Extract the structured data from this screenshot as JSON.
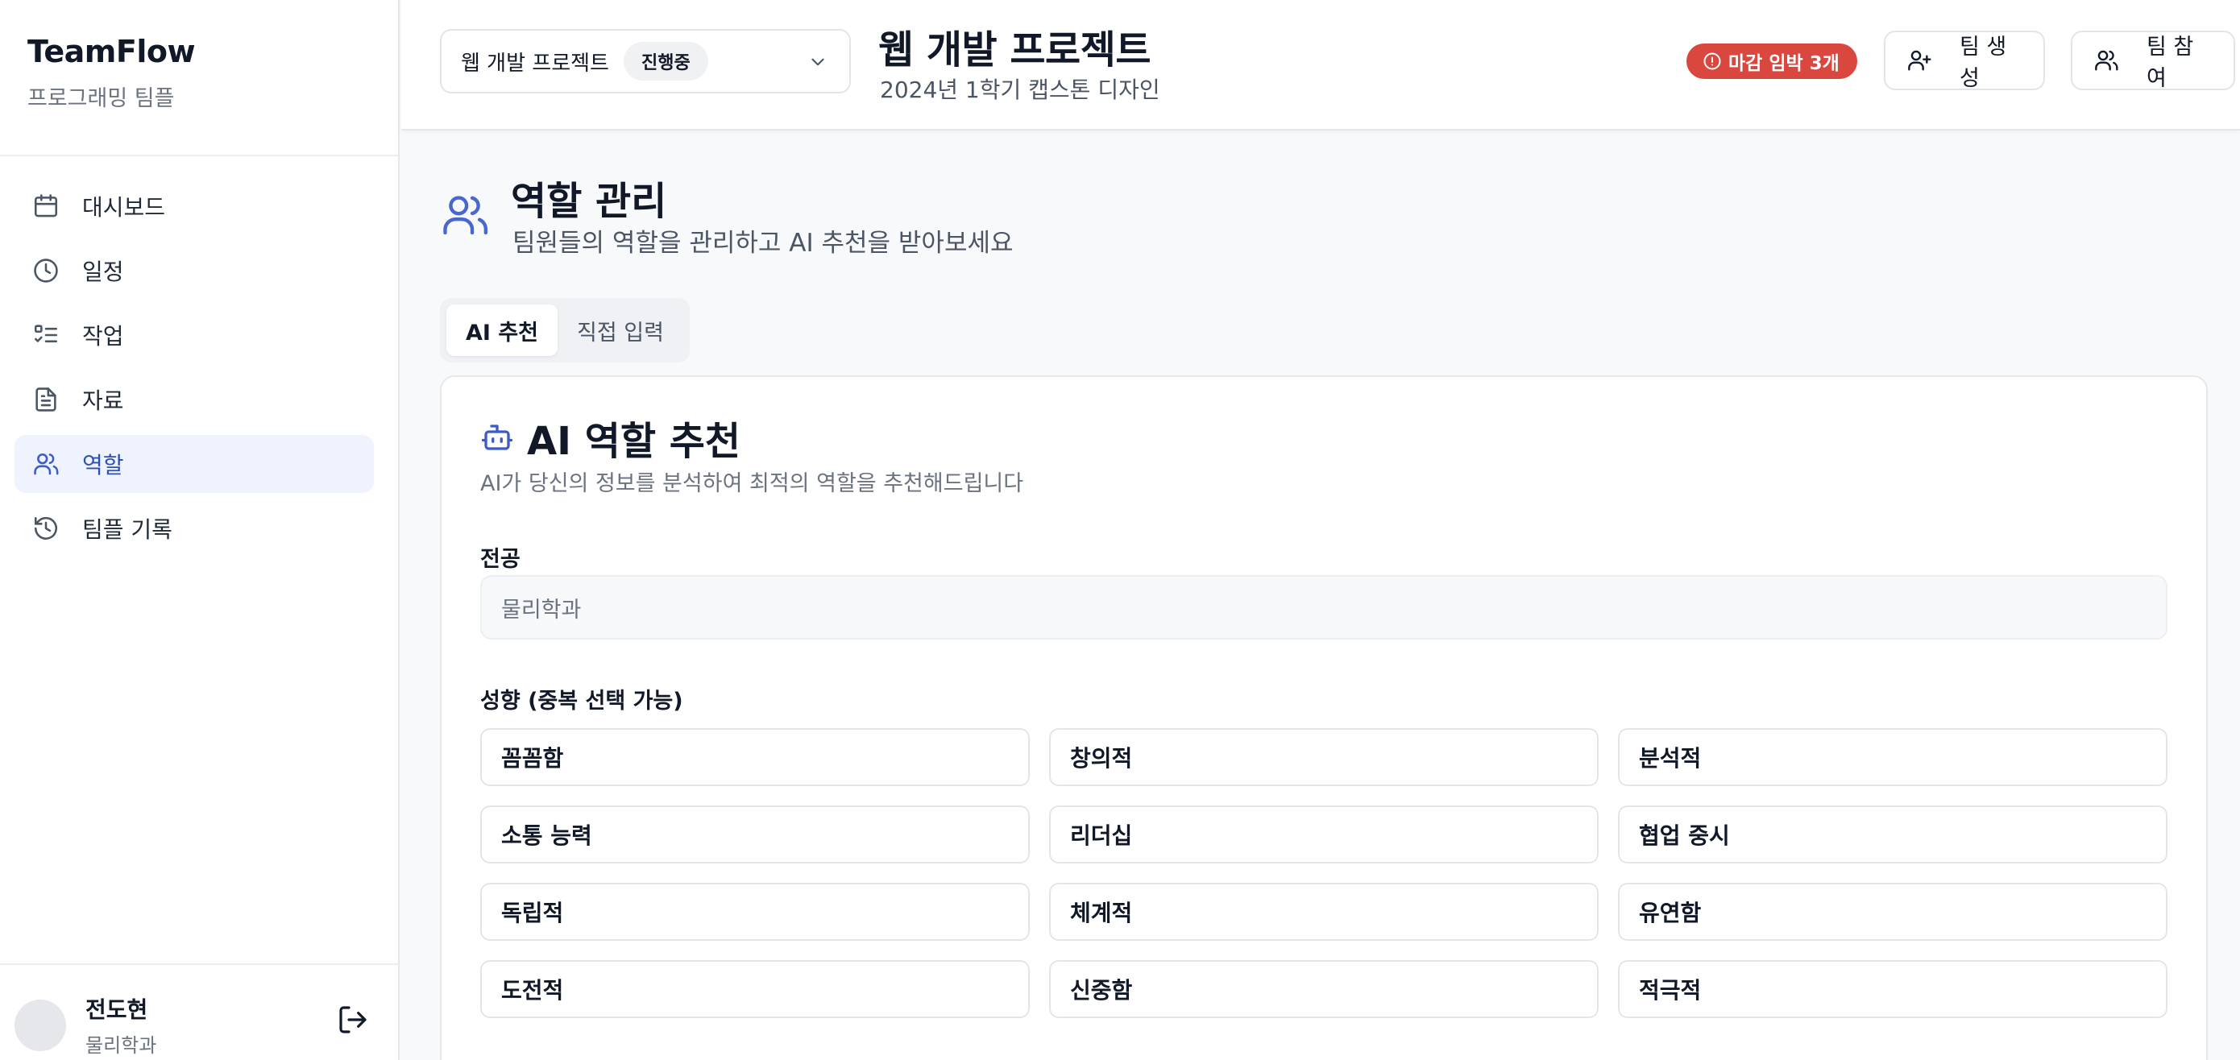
{
  "brand": {
    "title": "TeamFlow",
    "subtitle": "프로그래밍 팀플"
  },
  "sidebar": {
    "items": [
      {
        "label": "대시보드",
        "icon": "calendar-icon"
      },
      {
        "label": "일정",
        "icon": "clock-icon"
      },
      {
        "label": "작업",
        "icon": "checklist-icon"
      },
      {
        "label": "자료",
        "icon": "document-icon"
      },
      {
        "label": "역할",
        "icon": "users-icon",
        "active": true
      },
      {
        "label": "팀플 기록",
        "icon": "history-icon"
      }
    ]
  },
  "user": {
    "name": "전도현",
    "major": "물리학과"
  },
  "header": {
    "project_select": {
      "label": "웹 개발 프로젝트",
      "status": "진행중"
    },
    "title": "웹 개발 프로젝트",
    "subtitle": "2024년 1학기 캡스톤 디자인",
    "deadline_badge": "마감 임박 3개",
    "create_team": "팀 생성",
    "join_team": "팀 참여"
  },
  "page": {
    "title": "역할 관리",
    "subtitle": "팀원들의 역할을 관리하고 AI 추천을 받아보세요"
  },
  "tabs": [
    {
      "label": "AI 추천",
      "active": true
    },
    {
      "label": "직접 입력",
      "active": false
    }
  ],
  "card": {
    "title": "AI 역할 추천",
    "subtitle": "AI가 당신의 정보를 분석하여 최적의 역할을 추천해드립니다",
    "major_label": "전공",
    "major_value": "물리학과",
    "traits_label": "성향 (중복 선택 가능)",
    "traits": [
      "꼼꼼함",
      "창의적",
      "분석적",
      "소통 능력",
      "리더십",
      "협업 중시",
      "독립적",
      "체계적",
      "유연함",
      "도전적",
      "신중함",
      "적극적"
    ]
  },
  "colors": {
    "accent": "#3b5bc9",
    "active_bg": "#eef3fd",
    "danger": "#d9473f"
  }
}
